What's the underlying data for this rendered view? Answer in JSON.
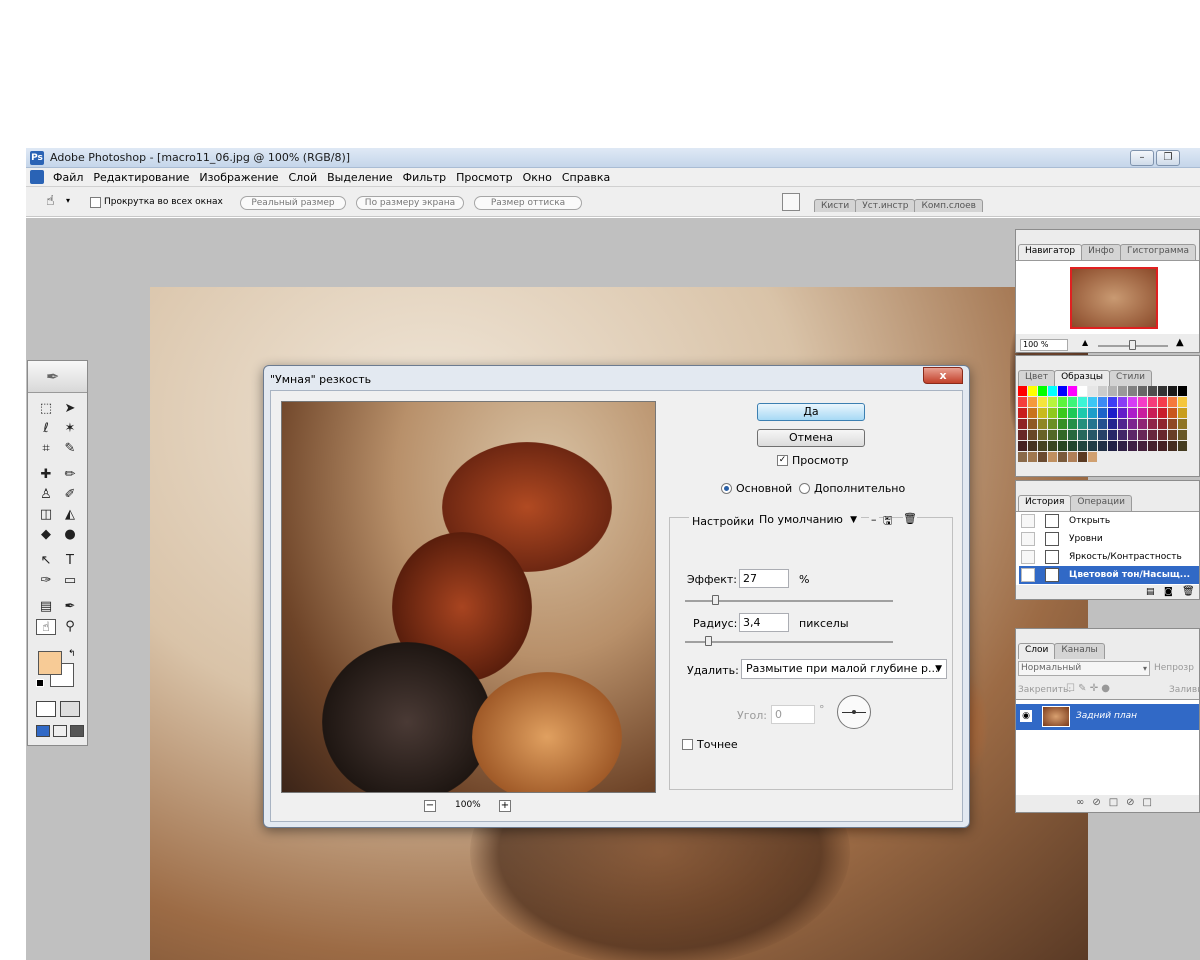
{
  "app": {
    "title": "Adobe Photoshop - [macro11_06.jpg @ 100% (RGB/8)]",
    "logo": "Ps"
  },
  "menu": [
    "Файл",
    "Редактирование",
    "Изображение",
    "Слой",
    "Выделение",
    "Фильтр",
    "Просмотр",
    "Окно",
    "Справка"
  ],
  "options_bar": {
    "scroll_all_label": "Прокрутка во всех окнах",
    "actual_size": "Реальный размер",
    "fit_screen": "По размеру экрана",
    "print_size": "Размер оттиска",
    "docked_tabs": [
      "Кисти",
      "Уст.инстр",
      "Комп.слоев"
    ]
  },
  "dialog": {
    "title": "\"Умная\" резкость",
    "close": "x",
    "ok": "Да",
    "cancel": "Отмена",
    "preview_label": "Просмотр",
    "preview_checked": true,
    "mode_basic": "Основной",
    "mode_advanced": "Дополнительно",
    "mode_selected": "basic",
    "settings_label": "Настройки:",
    "settings_value": "По умолчанию",
    "effect_label": "Эффект:",
    "effect_value": "27",
    "effect_unit": "%",
    "effect_fraction": 0.14,
    "radius_label": "Радиус:",
    "radius_value": "3,4",
    "radius_unit": "пикселы",
    "radius_fraction": 0.1,
    "remove_label": "Удалить:",
    "remove_value": "Размытие при малой глубине р...",
    "angle_label": "Угол:",
    "angle_value": "0",
    "angle_unit": "°",
    "more_accurate_label": "Точнее",
    "zoom_minus": "−",
    "zoom_value": "100%",
    "zoom_plus": "+"
  },
  "navigator": {
    "tabs": [
      "Навигатор",
      "Инфо",
      "Гистограмма"
    ],
    "zoom": "100 %"
  },
  "swatches": {
    "tabs": [
      "Цвет",
      "Образцы",
      "Стили"
    ]
  },
  "history": {
    "tabs": [
      "История",
      "Операции"
    ],
    "items": [
      "Открыть",
      "Уровни",
      "Яркость/Контрастность",
      "Цветовой тон/Насыщ..."
    ]
  },
  "layers": {
    "tabs": [
      "Слои",
      "Каналы"
    ],
    "blend_mode": "Нормальный",
    "opacity_label": "Непрозр",
    "lock_label": "Закрепить:",
    "fill_label": "Заливк",
    "layer_name": "Задний план"
  },
  "colors": {
    "accent": "#3169c6",
    "foreground_swatch": "#f7cb96",
    "background_swatch": "#ffffff"
  }
}
